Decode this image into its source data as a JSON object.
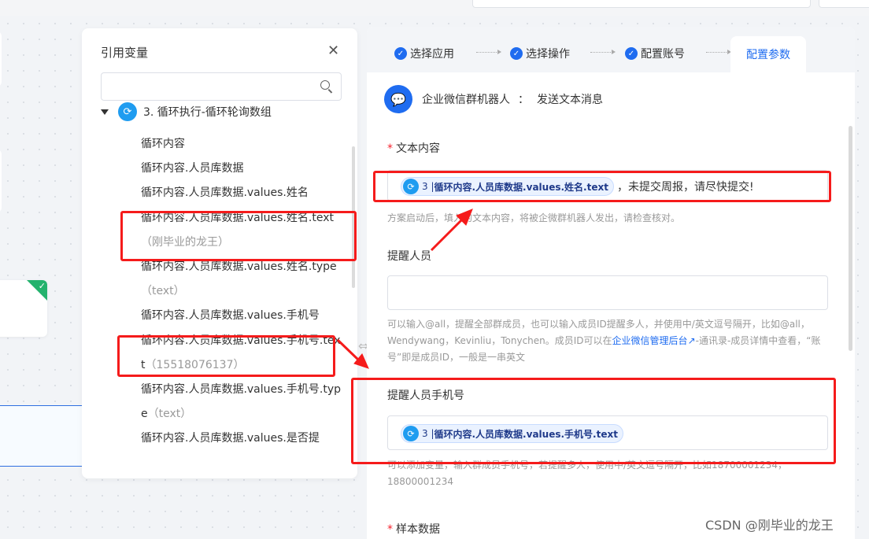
{
  "var_panel": {
    "title": "引用变量",
    "search_placeholder": "",
    "root_label": "3. 循环执行-循环轮询数组",
    "items": [
      {
        "label": "循环内容",
        "value": ""
      },
      {
        "label": "循环内容.人员库数据",
        "value": ""
      },
      {
        "label": "循环内容.人员库数据.values.姓名",
        "value": ""
      },
      {
        "label": "循环内容.人员库数据.values.姓名.text",
        "value": "（刚毕业的龙王）"
      },
      {
        "label": "循环内容.人员库数据.values.姓名.type",
        "value": "（text）"
      },
      {
        "label": "循环内容.人员库数据.values.手机号",
        "value": ""
      },
      {
        "label": "循环内容.人员库数据.values.手机号.text",
        "value": "（15518076137）"
      },
      {
        "label": "循环内容.人员库数据.values.手机号.type",
        "value": "（text）"
      },
      {
        "label": "循环内容.人员库数据.values.是否提",
        "value": ""
      }
    ]
  },
  "steps": {
    "s1": "选择应用",
    "s2": "选择操作",
    "s3": "配置账号",
    "active": "配置参数"
  },
  "app": {
    "name": "企业微信群机器人",
    "separator": "：",
    "action": "发送文本消息"
  },
  "fields": {
    "text_content": {
      "label": "文本内容",
      "chip_num": "3 | ",
      "chip_text": "循环内容.人员库数据.values.姓名.text",
      "after_chip": "，未提交周报，请尽快提交!",
      "hint": "方案启动后，填入的文本内容，将被企微群机器人发出，请检查核对。"
    },
    "remind_members": {
      "label": "提醒人员",
      "value": "",
      "hint_1": "可以输入@all，提醒全部群成员，也可以输入成员ID提醒多人，并使用中/英文逗号隔开，比如@all，Wendywang，Kevinliu，Tonychen。成员ID可以在",
      "hint_link": "企业微信管理后台",
      "hint_2": "-通讯录-成员详情中查看，“账号”即是成员ID，一般是一串英文"
    },
    "remind_phones": {
      "label": "提醒人员手机号",
      "chip_num": "3 | ",
      "chip_text": "循环内容.人员库数据.values.手机号.text",
      "hint": "可以添加变量，输入群成员手机号，若提醒多人，使用中/英文逗号隔开，比如18700001234，18800001234"
    },
    "sample_data": {
      "label": "样本数据"
    }
  },
  "watermark": "CSDN @刚毕业的龙王",
  "colors": {
    "primary": "#1f6cf0",
    "loop_icon": "#1f9cf0",
    "annotation_red": "#f51b1b",
    "success_green": "#23b26d"
  },
  "icons": {
    "close": "close-icon",
    "search": "search-icon",
    "loop": "loop-icon",
    "check": "check-icon",
    "app": "wecom-bot-icon",
    "resize": "resize-handle-icon"
  }
}
